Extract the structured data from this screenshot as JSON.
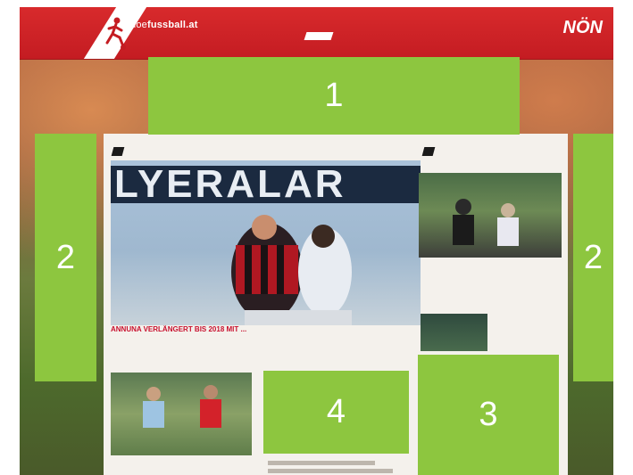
{
  "header": {
    "site_name_prefix": "noe",
    "site_name_main": "fussball.at",
    "brand": "NÖN",
    "top_links": [
      "",
      "",
      ""
    ],
    "nav_items": [
      "",
      "",
      "",
      "",
      ""
    ]
  },
  "main": {
    "section_label": "",
    "hero_banner_text": "LYERALAR",
    "hero_meta": "",
    "hero_headline": "ANNUNA VERLÄNGERT BIS 2018 MIT ...",
    "bottom_meta": "",
    "bottom_headline": ""
  },
  "sidebar": {
    "section_label": "",
    "item1_meta": "",
    "item1_headline": "",
    "item2_headline": ""
  },
  "ad_labels": {
    "slot1": "1",
    "slot2_left": "2",
    "slot2_right": "2",
    "slot3": "3",
    "slot4": "4"
  },
  "colors": {
    "header_red": "#c41c22",
    "headline_red": "#c8102e",
    "ad_green": "#8dc63f"
  }
}
